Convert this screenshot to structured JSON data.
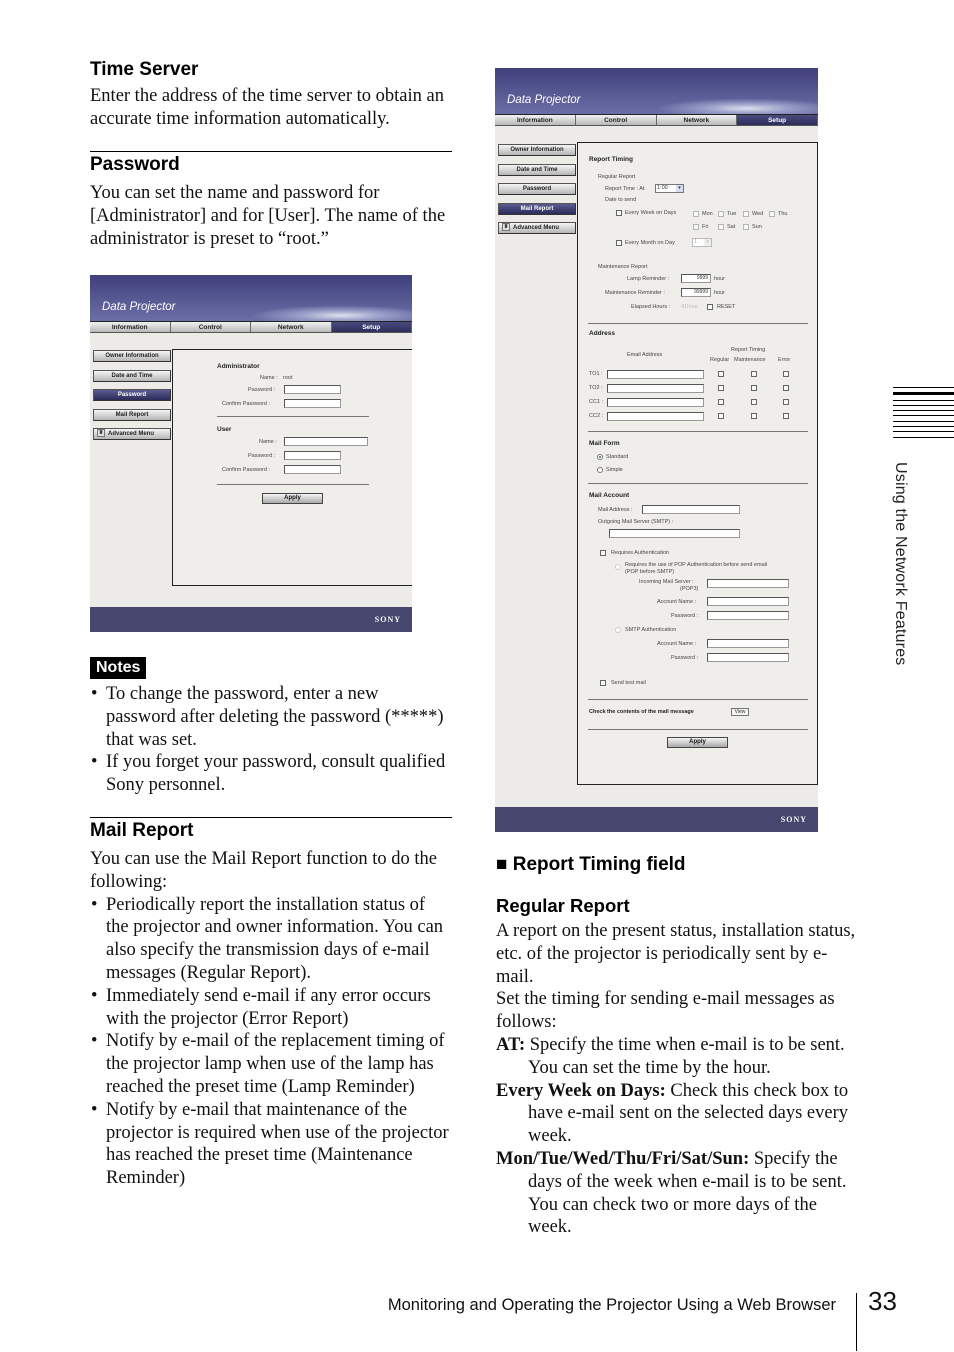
{
  "left_column": {
    "time_server": {
      "heading": "Time Server",
      "body": "Enter the address of the time server to obtain an accurate time information automatically."
    },
    "password": {
      "heading": "Password",
      "body": "You can set the name and password for [Administrator] and for [User]. The name of the administrator is preset to “root.”"
    },
    "notes": {
      "badge": "Notes",
      "items": [
        "To change the password, enter a new password after deleting the password (*****) that was set.",
        "If you forget your password, consult qualified Sony personnel."
      ]
    },
    "mail_report": {
      "heading": "Mail Report",
      "intro": "You can use the Mail Report function to do the following:",
      "items": [
        "Periodically report the installation status of the projector and owner information. You can also specify the transmission days of e-mail messages (Regular Report).",
        "Immediately send e-mail if any error occurs with the projector (Error Report)",
        "Notify by e-mail of the replacement timing of the projector lamp when use of the lamp has reached the preset time (Lamp Reminder)",
        "Notify by e-mail that maintenance of the projector is required when use of the projector has reached the preset time (Maintenance Reminder)"
      ]
    }
  },
  "ui_common": {
    "app_title": "Data Projector",
    "tabs": [
      "Information",
      "Control",
      "Network",
      "Setup"
    ],
    "active_tab": "Setup",
    "side_menu": [
      "Owner Information",
      "Date and Time",
      "Password",
      "Mail Report",
      "Advanced Menu"
    ],
    "brand": "SONY",
    "apply_label": "Apply"
  },
  "password_screen": {
    "active_menu": "Password",
    "admin": {
      "heading": "Administrator",
      "name_label": "Name :",
      "name_value": "root",
      "password_label": "Password :",
      "confirm_label": "Confirm Password :"
    },
    "user": {
      "heading": "User",
      "name_label": "Name :",
      "password_label": "Password :",
      "confirm_label": "Confirm Password :"
    }
  },
  "mail_screen": {
    "active_menu": "Mail Report",
    "report_timing": {
      "heading": "Report Timing",
      "regular_report": "Regular Report",
      "report_time_label": "Report Time : At",
      "report_time_value": "1:00",
      "date_to_send": "Date to send",
      "every_week_label": "Every Week on Days",
      "days": [
        "Mon",
        "Tue",
        "Wed",
        "Thu",
        "Fri",
        "Sat",
        "Sun"
      ],
      "every_month_label": "Every Month on Day",
      "every_month_value": "1",
      "maintenance_report": "Maintenance Report",
      "lamp_reminder_label": "Lamp Reminder :",
      "lamp_reminder_value": "9999",
      "maintenance_reminder_label": "Maintenance Reminder :",
      "maintenance_reminder_value": "99999",
      "hour_unit": "hour",
      "elapsed_label": "Elapsed Hours :",
      "elapsed_value": "41hour",
      "reset_label": "RESET"
    },
    "address": {
      "heading": "Address",
      "email_col": "Email Address",
      "timing_col": "Report Timing",
      "sub_cols": [
        "Regular",
        "Maintenance",
        "Error"
      ],
      "rows": [
        "TO1 :",
        "TO2 :",
        "CC1 :",
        "CC2 :"
      ]
    },
    "mail_form": {
      "heading": "Mail Form",
      "options": [
        "Standard",
        "Simple"
      ],
      "selected": "Standard"
    },
    "mail_account": {
      "heading": "Mail Account",
      "mail_address_label": "Mail Address :",
      "smtp_label": "Outgoing Mail Server (SMTP) :",
      "requires_auth_label": "Requires Authentication",
      "pop_before_smtp_label": "Requires the use of POP Authentication before send email",
      "pop_before_smtp_sub": "(POP before SMTP)",
      "incoming_label": "Incoming Mail Server :",
      "incoming_sub": "(POP3)",
      "account_name_label": "Account Name :",
      "password_label": "Password :",
      "smtp_auth_label": "SMTP Authentication",
      "send_test_label": "Send test mail"
    },
    "check_contents_label": "Check the contents of the mail message",
    "view_label": "View"
  },
  "right_column": {
    "section_heading": "Report Timing field",
    "sub_heading": "Regular Report",
    "para1": "A report on the present status, installation status, etc. of the projector is periodically sent by e-mail.",
    "para2": "Set the timing for sending e-mail messages as follows:",
    "definitions": [
      {
        "term": "AT:",
        "desc": " Specify the time when e-mail is to be sent. You can set the time by the hour."
      },
      {
        "term": "Every Week on Days:",
        "desc": " Check this check box to have e-mail sent on the selected days every week."
      },
      {
        "term": "Mon/Tue/Wed/Thu/Fri/Sat/Sun:",
        "desc": " Specify the days of the week when e-mail is to be sent. You can check two or more days of the week."
      }
    ]
  },
  "side_tab": {
    "label": "Using the Network Features"
  },
  "footer": {
    "title": "Monitoring and Operating the Projector Using a Web Browser",
    "page_number": "33"
  }
}
